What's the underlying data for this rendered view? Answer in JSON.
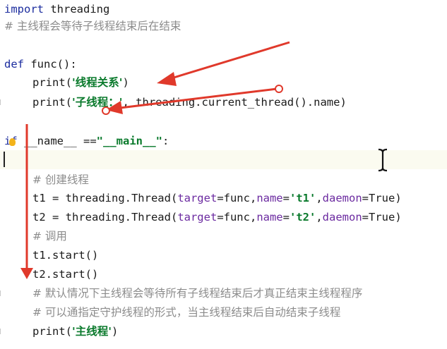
{
  "code": {
    "l1": {
      "kw": "import",
      "rest": " threading"
    },
    "l2": {
      "comment": "# 主线程会等待子线程结束后在结束"
    },
    "l4": {
      "kw": "def",
      "rest": " func():"
    },
    "l5": {
      "func": "print(",
      "str": "'线程关系'",
      "close": ")"
    },
    "l6": {
      "func": "print(",
      "str": "'子线程：'",
      "rest": ", threading.current_thread().name)"
    },
    "l8": {
      "kw": "if",
      "pre": " ",
      "dunder1": "__name__",
      "mid": " ==",
      "str": "\"__main__\"",
      "colon": ":"
    },
    "l10": {
      "comment": "# 创建线程"
    },
    "l11": {
      "pre": "t1 = threading.Thread(",
      "p1": "target",
      "v1": "=func,",
      "p2": "name",
      "eq": "=",
      "s": "'t1'",
      "c": ",",
      "p3": "daemon",
      "v3": "=True)"
    },
    "l12": {
      "pre": "t2 = threading.Thread(",
      "p1": "target",
      "v1": "=func,",
      "p2": "name",
      "eq": "=",
      "s": "'t2'",
      "c": ",",
      "p3": "daemon",
      "v3": "=True)"
    },
    "l13": {
      "comment": "# 调用"
    },
    "l14": {
      "text": "t1.start()"
    },
    "l15": {
      "text": "t2.start()"
    },
    "l16": {
      "comment": "# 默认情况下主线程会等待所有子线程结束后才真正结束主线程程序"
    },
    "l17": {
      "comment": "# 可以通指定守护线程的形式，当主线程结束后自动结束子线程"
    },
    "l18": {
      "func": "print(",
      "str": "'主线程'",
      "close": ")"
    }
  },
  "colors": {
    "keyword": "#1b2c9e",
    "string": "#0a7a2c",
    "comment": "#8c8c8c",
    "annotation_arrow": "#e0392b"
  },
  "icons": [
    "intention-bulb-icon",
    "text-cursor-icon"
  ]
}
